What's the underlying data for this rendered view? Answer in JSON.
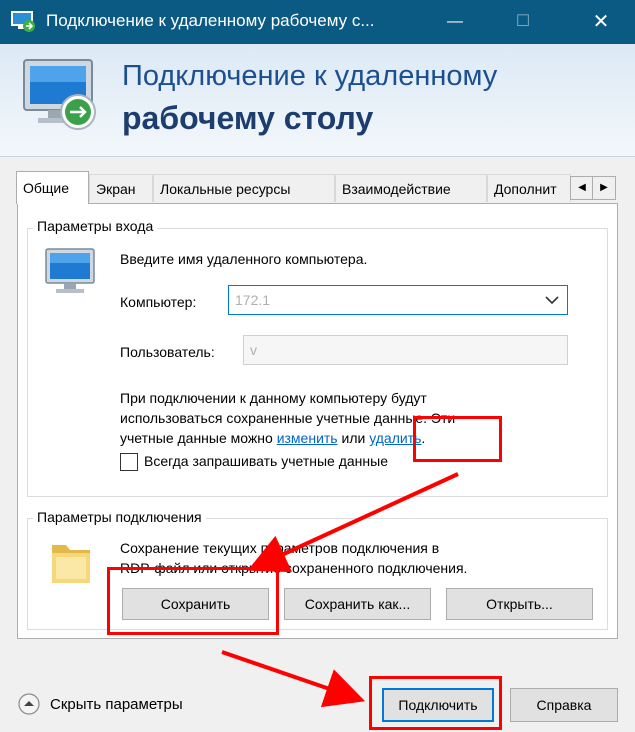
{
  "window": {
    "title": "Подключение к удаленному рабочему с..."
  },
  "banner": {
    "line1": "Подключение к удаленному",
    "line2": "рабочему столу"
  },
  "tabs": [
    {
      "label": "Общие",
      "active": true
    },
    {
      "label": "Экран",
      "active": false
    },
    {
      "label": "Локальные ресурсы",
      "active": false
    },
    {
      "label": "Взаимодействие",
      "active": false
    },
    {
      "label": "Дополнит",
      "active": false
    }
  ],
  "login": {
    "legend": "Параметры входа",
    "prompt": "Введите имя удаленного компьютера.",
    "computer_label": "Компьютер:",
    "computer_value": "172.1",
    "user_label": "Пользователь:",
    "user_value": "v",
    "info_line1": "При подключении к данному компьютеру будут",
    "info_line2": "использоваться сохраненные учетные данные. Эти",
    "info_line3_prefix": "учетные данные можно",
    "link_edit": "изменить",
    "info_or": "или",
    "link_delete": "удалить",
    "info_period": ".",
    "always_ask_label": "Всегда запрашивать учетные данные",
    "always_ask_checked": false
  },
  "connection": {
    "legend": "Параметры подключения",
    "desc_line1": "Сохранение текущих параметров подключения в",
    "desc_line2": "RDP-файл или открытие сохраненного подключения.",
    "save_label": "Сохранить",
    "save_as_label": "Сохранить как...",
    "open_label": "Открыть..."
  },
  "footer": {
    "hide_options_label": "Скрыть параметры",
    "connect_label": "Подключить",
    "help_label": "Справка"
  },
  "colors": {
    "titlebar": "#0b5a83",
    "accent": "#0078d7",
    "annotation": "#ff0000",
    "link": "#0066cc"
  }
}
